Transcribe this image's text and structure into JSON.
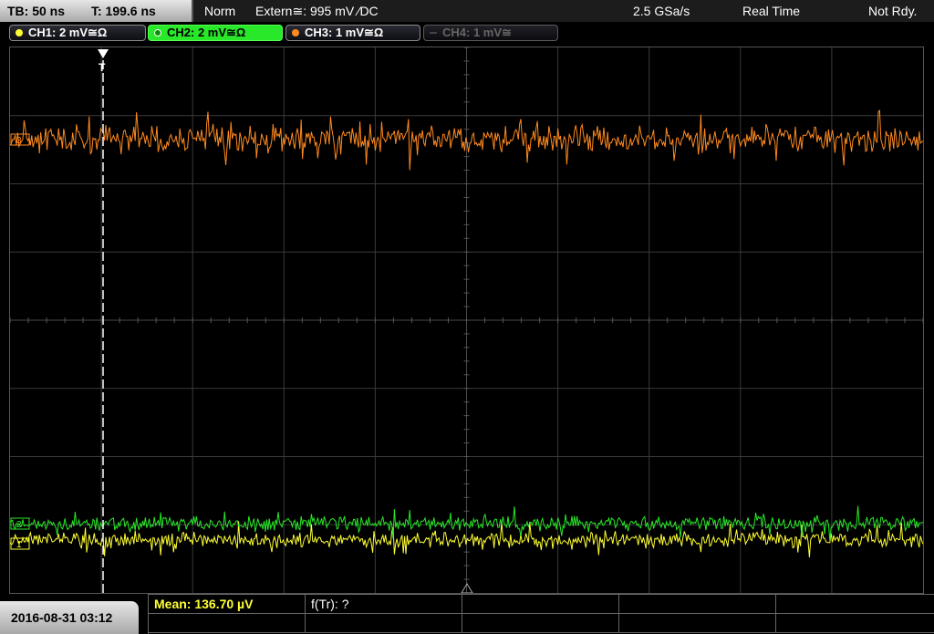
{
  "topbar": {
    "timebase": "TB: 50 ns",
    "trigger_pos": "T: 199.6 ns",
    "trigger_mode": "Norm",
    "trigger_source": "Extern≅: 995 mV ⁄DC",
    "sample_rate": "2.5 GSa/s",
    "acq_mode": "Real Time",
    "status": "Not Rdy."
  },
  "channels": [
    {
      "label": "CH1: 2 mV≅Ω",
      "color": "#ffff33",
      "active": true
    },
    {
      "label": "CH2: 2 mV≅Ω",
      "color": "#29e829",
      "active": true,
      "selected": true
    },
    {
      "label": "CH3: 1 mV≅Ω",
      "color": "#ff8a1f",
      "active": true
    },
    {
      "label": "CH4: 1 mV≅",
      "color": "#555555",
      "active": false
    }
  ],
  "display": {
    "trigger_marker": "T",
    "ch3_marker": "3",
    "ch2_marker": "2",
    "ch1_marker": "1"
  },
  "bottom": {
    "datetime": "2016-08-31 03:12",
    "measurements": [
      {
        "label": "Mean: 136.70 µV"
      },
      {
        "label": "f(Tr): ?"
      },
      {
        "label": ""
      },
      {
        "label": ""
      }
    ]
  },
  "colors": {
    "ch1": "#ffff33",
    "ch2": "#29e829",
    "ch3": "#ff8a1f",
    "grid": "#3a3a3a"
  }
}
